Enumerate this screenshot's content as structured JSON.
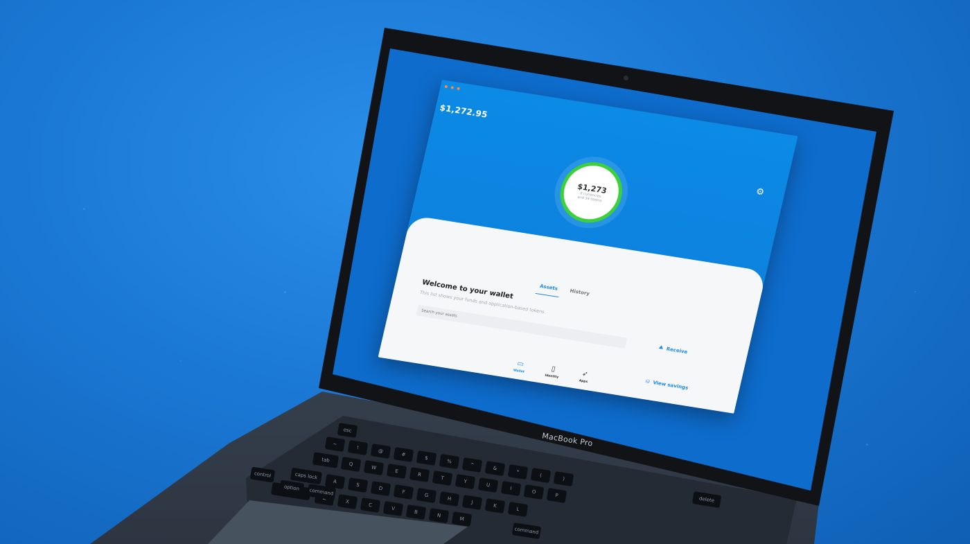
{
  "app": {
    "header_balance": "$1,272.95",
    "ring": {
      "amount": "$1,273",
      "sub_line1": "8 currencies",
      "sub_line2": "and 34 tokens",
      "ring_color": "#3bd13b"
    },
    "tabs": [
      {
        "label": "Assets",
        "active": true
      },
      {
        "label": "History",
        "active": false
      }
    ],
    "welcome_title": "Welcome to your wallet",
    "welcome_subtitle": "This list shows your funds and application-based tokens.",
    "search_placeholder": "Search your assets",
    "actions": {
      "receive": "Receive",
      "view_savings": "View savings"
    },
    "nav": [
      {
        "label": "Wallet",
        "icon": "wallet-icon",
        "active": true
      },
      {
        "label": "Identity",
        "icon": "identity-icon",
        "active": false
      },
      {
        "label": "Apps",
        "icon": "rocket-icon",
        "active": false
      }
    ],
    "accent_color": "#1a8ce8",
    "header_color": "#0b8ae6"
  },
  "laptop": {
    "brand": "MacBook Pro",
    "keys": {
      "row1": [
        "esc",
        "",
        "",
        "",
        "",
        "",
        "",
        "",
        "",
        "",
        "",
        ""
      ],
      "row2": [
        "~",
        "!",
        "@",
        "#",
        "$",
        "%",
        "^",
        "&",
        "*",
        "(",
        ")",
        "delete"
      ],
      "row3": [
        "tab",
        "Q",
        "W",
        "E",
        "R",
        "T",
        "Y",
        "U",
        "I",
        "O",
        "P"
      ],
      "row4": [
        "caps lock",
        "A",
        "S",
        "D",
        "F",
        "G",
        "H",
        "J",
        "K",
        "L"
      ],
      "row5": [
        "shift",
        "Z",
        "X",
        "C",
        "V",
        "B",
        "N",
        "M"
      ],
      "row6": [
        "control",
        "option",
        "command",
        "command"
      ]
    }
  }
}
